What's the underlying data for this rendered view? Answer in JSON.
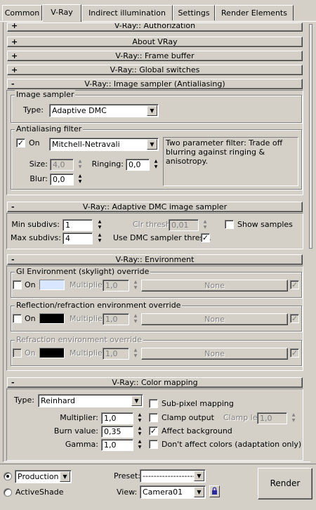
{
  "tabs": [
    {
      "label": "Common"
    },
    {
      "label": "V-Ray"
    },
    {
      "label": "Indirect illumination"
    },
    {
      "label": "Settings"
    },
    {
      "label": "Render Elements"
    }
  ],
  "rollouts": {
    "authorization": {
      "sign": "+",
      "title": "V-Ray:: Authorization"
    },
    "about": {
      "sign": "+",
      "title": "About VRay"
    },
    "frame_buffer": {
      "sign": "+",
      "title": "V-Ray:: Frame buffer"
    },
    "global_switches": {
      "sign": "+",
      "title": "V-Ray:: Global switches"
    },
    "image_sampler": {
      "sign": "-",
      "title": "V-Ray:: Image sampler (Antialiasing)"
    },
    "adaptive_dmc": {
      "sign": "-",
      "title": "V-Ray:: Adaptive DMC image sampler"
    },
    "environment": {
      "sign": "-",
      "title": "V-Ray:: Environment"
    },
    "color_mapping": {
      "sign": "-",
      "title": "V-Ray:: Color mapping"
    }
  },
  "image_sampler": {
    "group_title": "Image sampler",
    "type_label": "Type:",
    "type_value": "Adaptive DMC",
    "aa_group_title": "Antialiasing filter",
    "aa_on_label": "On",
    "aa_on_checked": "✓",
    "filter_value": "Mitchell-Netravali",
    "filter_description": "Two parameter filter: Trade off blurring against ringing & anisotropy.",
    "size_label": "Size:",
    "size_value": "4,0",
    "ringing_label": "Ringing:",
    "ringing_value": "0,0",
    "blur_label": "Blur:",
    "blur_value": "0,0"
  },
  "adaptive_dmc": {
    "min_subdivs_label": "Min subdivs:",
    "min_subdivs_value": "1",
    "max_subdivs_label": "Max subdivs:",
    "max_subdivs_value": "4",
    "clr_thresh_label": "Clr thresh:",
    "clr_thresh_value": "0,01",
    "use_dmc_label": "Use DMC sampler thresh.",
    "use_dmc_checked": "✓",
    "show_samples_label": "Show samples"
  },
  "environment": {
    "gi_group_title": "GI Environment (skylight) override",
    "gi_on_label": "On",
    "gi_color": "#d8e6ff",
    "gi_multiplier_label": "Multiplier:",
    "gi_multiplier_value": "1,0",
    "gi_map_label": "None",
    "refl_group_title": "Reflection/refraction environment override",
    "refl_on_label": "On",
    "refl_color": "#000000",
    "refl_multiplier_label": "Multiplier:",
    "refl_multiplier_value": "1,0",
    "refl_map_label": "None",
    "refr_group_title": "Refraction environment override",
    "refr_on_label": "On",
    "refr_color": "#000000",
    "refr_multiplier_label": "Multiplier:",
    "refr_multiplier_value": "1,0",
    "refr_map_label": "None",
    "map_toggle_checked": "✓"
  },
  "color_mapping": {
    "type_label": "Type:",
    "type_value": "Reinhard",
    "multiplier_label": "Multiplier:",
    "multiplier_value": "1,0",
    "burn_label": "Burn value:",
    "burn_value": "0,35",
    "gamma_label": "Gamma:",
    "gamma_value": "1,0",
    "subpixel_label": "Sub-pixel mapping",
    "clamp_label": "Clamp output",
    "clamp_level_label": "Clamp level:",
    "clamp_level_value": "1,0",
    "affect_bg_label": "Affect background",
    "affect_bg_checked": "✓",
    "dont_affect_label": "Don't affect colors (adaptation only)"
  },
  "bottom": {
    "production_label": "Production",
    "activeshade_label": "ActiveShade",
    "preset_label": "Preset:",
    "preset_value": "----------------------",
    "view_label": "View:",
    "view_value": "Camera01",
    "render_label": "Render"
  }
}
